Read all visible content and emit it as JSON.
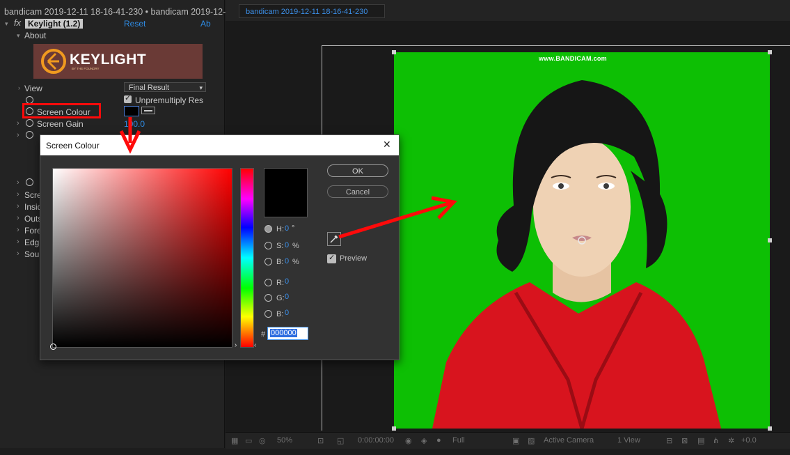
{
  "effect_controls": {
    "title": "bandicam 2019-12-11 18-16-41-230 • bandicam 2019-12-",
    "effect_badge": "fx",
    "effect_name": "Keylight (1.2)",
    "reset_label": "Reset",
    "about_link": "Ab",
    "about_label": "About",
    "banner_title": "KEYLIGHT",
    "banner_sub": "BY THE FOUNDRY",
    "view_label": "View",
    "view_value": "Final Result",
    "unpremultiply_label": "Unpremultiply Res",
    "screen_colour_label": "Screen Colour",
    "screen_gain_label": "Screen Gain",
    "screen_gain_value": "100.0",
    "truncated_rows": [
      "Scre",
      "Insid",
      "Outs",
      "Fore",
      "Edg",
      "Sou"
    ]
  },
  "viewer": {
    "tab_label": "bandicam 2019-12-11 18-16-41-230",
    "watermark": "www.BANDICAM.com",
    "zoom": "50%",
    "timecode": "0:00:00:00",
    "resolution": "Full",
    "camera": "Active Camera",
    "view_count": "1 View",
    "exposure": "+0.0"
  },
  "dialog": {
    "title": "Screen Colour",
    "close_glyph": "✕",
    "ok_label": "OK",
    "cancel_label": "Cancel",
    "preview_label": "Preview",
    "hex_prefix": "#",
    "hex_value": "000000",
    "fields": [
      {
        "label": "H:",
        "value": "0",
        "unit": "°"
      },
      {
        "label": "S:",
        "value": "0",
        "unit": "%"
      },
      {
        "label": "B:",
        "value": "0",
        "unit": "%"
      },
      {
        "label": "R:",
        "value": "0",
        "unit": ""
      },
      {
        "label": "G:",
        "value": "0",
        "unit": ""
      },
      {
        "label": "B:",
        "value": "0",
        "unit": ""
      }
    ],
    "selected_color": "#000000"
  },
  "colors": {
    "green_screen": "#0dbf04",
    "annotation_red": "#ff0a0a",
    "accent_blue": "#3c8fe8"
  }
}
